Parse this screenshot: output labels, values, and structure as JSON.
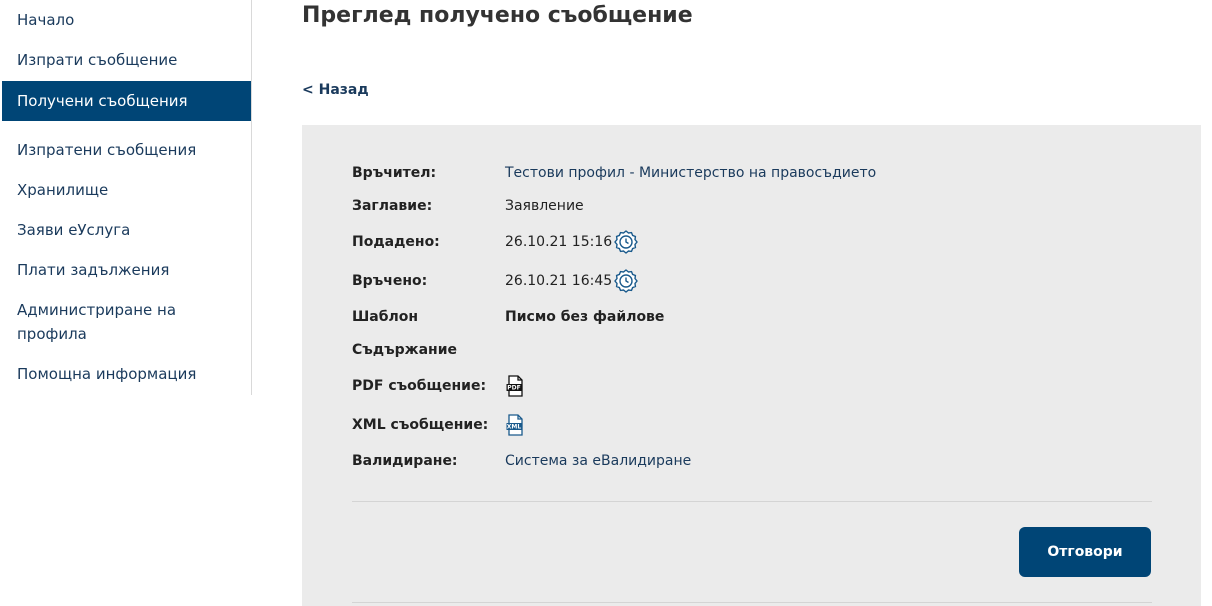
{
  "sidebar": {
    "items": [
      {
        "label": "Начало"
      },
      {
        "label": "Изпрати съобщение"
      },
      {
        "label": "Получени съобщения"
      },
      {
        "label": "Изпратени съобщения"
      },
      {
        "label": "Хранилище"
      },
      {
        "label": "Заяви еУслуга"
      },
      {
        "label": "Плати задължения"
      },
      {
        "label": "Администриране на профила"
      },
      {
        "label": "Помощна информация"
      }
    ]
  },
  "main": {
    "title": "Преглед получено съобщение",
    "back_label": "< Назад",
    "fields": {
      "sender_label": "Връчител:",
      "sender_value": "Тестови профил - Министерство на правосъдието",
      "subject_label": "Заглавие:",
      "subject_value": "Заявление",
      "submitted_label": "Подадено:",
      "submitted_value": "26.10.21 15:16",
      "delivered_label": "Връчено:",
      "delivered_value": "26.10.21 16:45",
      "template_label": "Шаблон",
      "template_value": "Писмо без файлове",
      "content_label": "Съдържание",
      "pdf_label": "PDF съобщение:",
      "pdf_icon_text": "PDF",
      "xml_label": "XML съобщение:",
      "xml_icon_text": "XML",
      "validation_label": "Валидиране:",
      "validation_value": "Система за еВалидиране"
    },
    "reply_label": "Отговори"
  },
  "colors": {
    "accent": "#004576",
    "link": "#1a3a5c",
    "panel": "#ebebeb"
  },
  "icons": [
    "clock-icon",
    "pdf-file-icon",
    "xml-file-icon"
  ]
}
